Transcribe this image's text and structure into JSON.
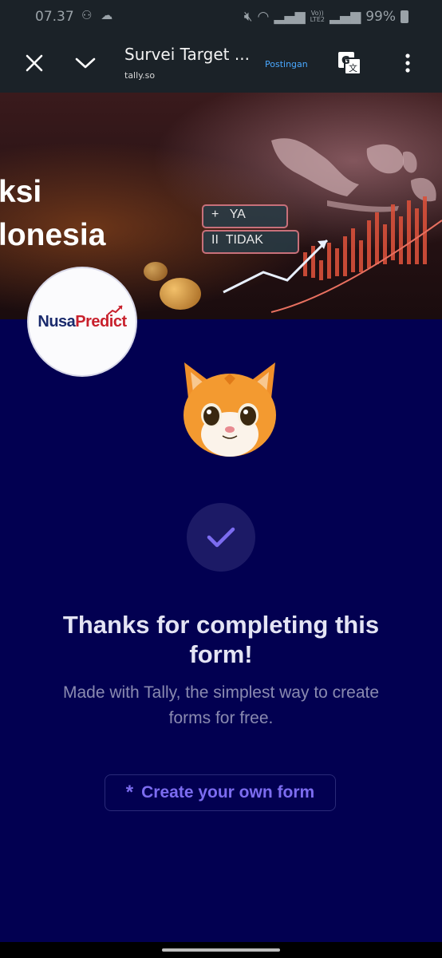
{
  "status_bar": {
    "time": "07.37",
    "left_icons": "☁",
    "network_label_top": "Vo))",
    "network_label_bottom": "LTE2",
    "battery": "99%"
  },
  "toolbar": {
    "title": "Survei Target ...",
    "url": "tally.so",
    "postingan": "Postingan",
    "icons": [
      "close-icon",
      "chevron-down-icon",
      "translate-icon",
      "more-vert-icon"
    ]
  },
  "banner": {
    "line1": "ksi",
    "line2": "lonesia",
    "vote_yes": "YA",
    "vote_yes_symbol": "+",
    "vote_no": "TIDAK",
    "vote_no_symbol": "II"
  },
  "logo": {
    "part1": "Nusa",
    "part2": "Predict"
  },
  "confirmation": {
    "title": "Thanks for completing this form!",
    "subtitle": "Made with Tally, the simplest way to create forms for free.",
    "button_label": "Create your own form",
    "button_icon": "*"
  },
  "colors": {
    "page_background": "#020051",
    "accent": "#7c6cf0",
    "check_circle": "#1c1a66"
  }
}
